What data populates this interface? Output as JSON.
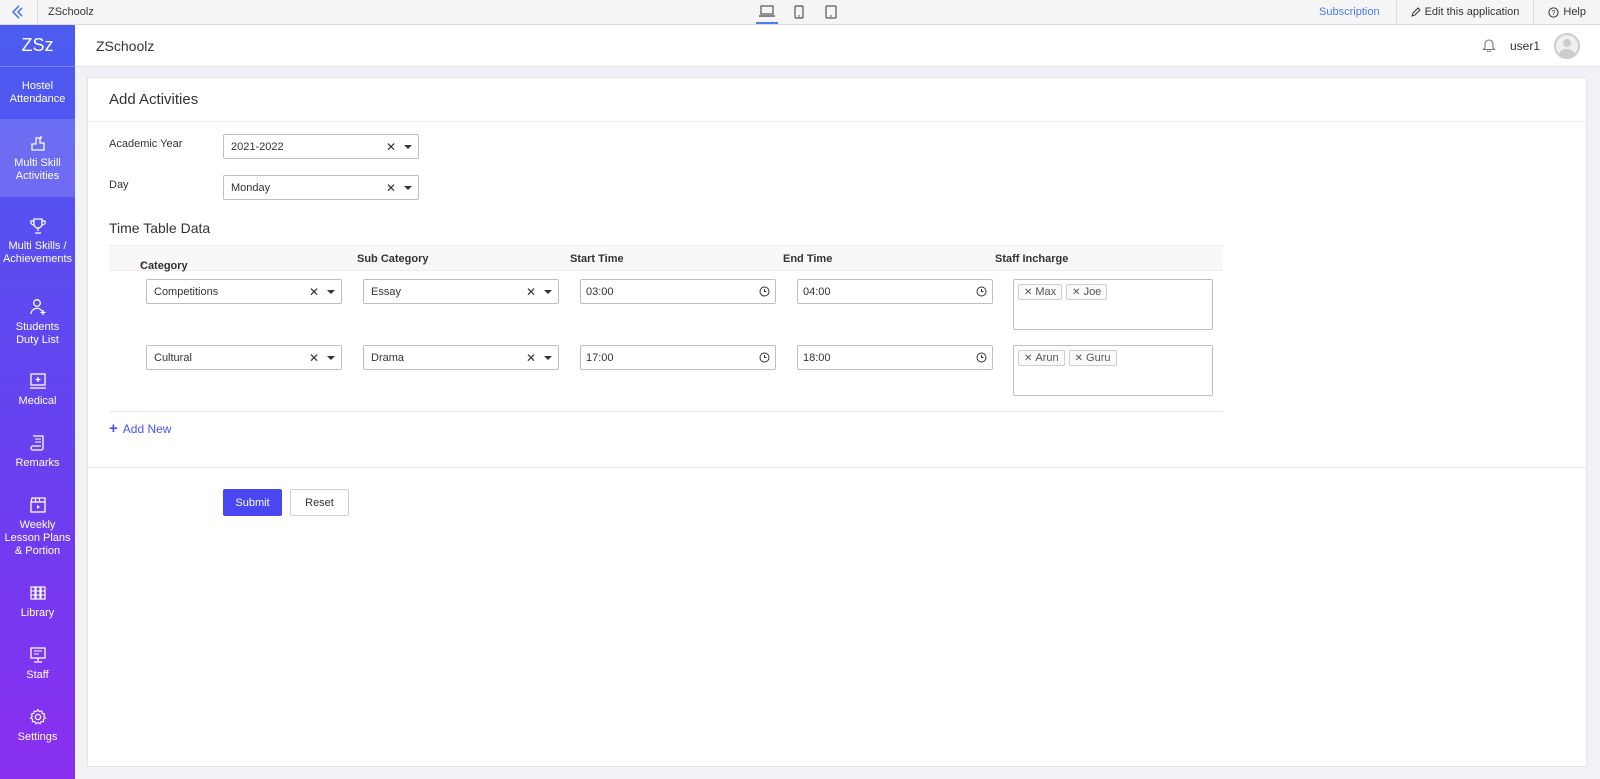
{
  "topbar": {
    "app_name": "ZSchoolz",
    "devices": [
      "laptop-icon",
      "mobile-icon",
      "tablet-icon"
    ],
    "subscription": "Subscription",
    "edit_app": "Edit this application",
    "help": "Help"
  },
  "sidebar": {
    "brand": "ZSz",
    "items": [
      {
        "label": "Hostel Attendance",
        "icon": "none"
      },
      {
        "label": "Multi Skill Activities",
        "icon": "activity-icon",
        "active": true
      },
      {
        "label": "Multi Skills / Achievements",
        "icon": "trophy-icon"
      },
      {
        "label": "Students Duty List",
        "icon": "user-add-icon"
      },
      {
        "label": "Medical",
        "icon": "medical-icon"
      },
      {
        "label": "Remarks",
        "icon": "scroll-icon"
      },
      {
        "label": "Weekly Lesson Plans & Portion",
        "icon": "clapboard-icon"
      },
      {
        "label": "Library",
        "icon": "library-icon"
      },
      {
        "label": "Staff",
        "icon": "monitor-icon"
      },
      {
        "label": "Settings",
        "icon": "gear-icon"
      }
    ]
  },
  "header": {
    "title": "ZSchoolz",
    "user": "user1"
  },
  "form": {
    "title": "Add Activities",
    "academic_year": {
      "label": "Academic Year",
      "value": "2021-2022"
    },
    "day": {
      "label": "Day",
      "value": "Monday"
    },
    "section_title": "Time Table Data",
    "columns": {
      "category": "Category",
      "sub_category": "Sub Category",
      "start_time": "Start Time",
      "end_time": "End Time",
      "staff": "Staff Incharge"
    },
    "rows": [
      {
        "category": "Competitions",
        "sub_category": "Essay",
        "start": "03:00",
        "end": "04:00",
        "staff": [
          "Max",
          "Joe"
        ]
      },
      {
        "category": "Cultural",
        "sub_category": "Drama",
        "start": "17:00",
        "end": "18:00",
        "staff": [
          "Arun",
          "Guru"
        ]
      }
    ],
    "add_new": "Add New",
    "submit": "Submit",
    "reset": "Reset"
  },
  "colors": {
    "accent": "#4a46f0",
    "link": "#4a7de8",
    "required": "#e74c3c"
  }
}
